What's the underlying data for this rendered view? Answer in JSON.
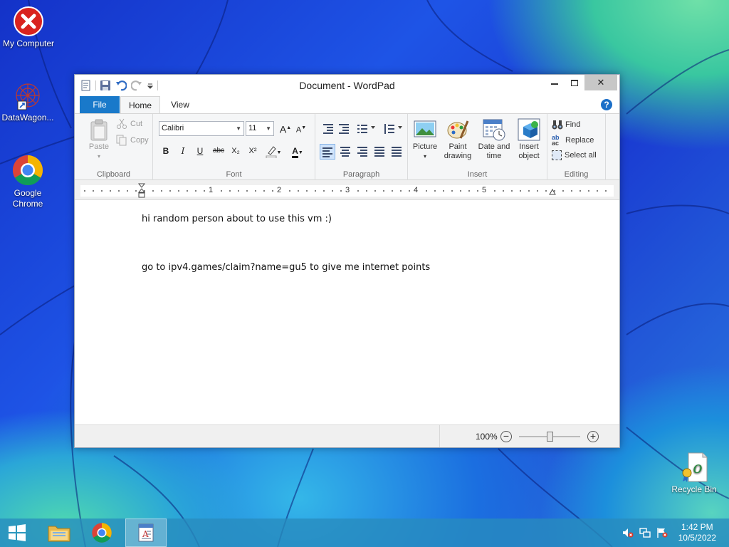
{
  "desktop": {
    "icons": [
      {
        "label": "My Computer"
      },
      {
        "label": "DataWagon..."
      },
      {
        "label": "Google Chrome"
      },
      {
        "label": "Recycle Bin"
      }
    ]
  },
  "window": {
    "title": "Document - WordPad",
    "tabs": {
      "file": "File",
      "home": "Home",
      "view": "View"
    },
    "help": "?",
    "controls": {
      "minimize": "—",
      "maximize": "☐",
      "close": "✕"
    }
  },
  "ribbon": {
    "clipboard": {
      "label": "Clipboard",
      "paste": "Paste",
      "cut": "Cut",
      "copy": "Copy"
    },
    "font": {
      "label": "Font",
      "family": "Calibri",
      "size": "11",
      "bold": "B",
      "italic": "I",
      "underline": "U",
      "strike": "abc",
      "subscript": "X₂",
      "superscript": "X²",
      "grow": "A",
      "shrink": "A",
      "color": "A"
    },
    "paragraph": {
      "label": "Paragraph"
    },
    "insert": {
      "label": "Insert",
      "picture": "Picture",
      "paint_line1": "Paint",
      "paint_line2": "drawing",
      "datetime_line1": "Date and",
      "datetime_line2": "time",
      "object_line1": "Insert",
      "object_line2": "object"
    },
    "editing": {
      "label": "Editing",
      "find": "Find",
      "replace": "Replace",
      "select_all": "Select all"
    }
  },
  "ruler": {
    "marks": [
      "1",
      "2",
      "3",
      "4",
      "5"
    ]
  },
  "document": {
    "lines": [
      "hi random person about to use this vm :)",
      "go to ipv4.games/claim?name=gu5 to give me internet points"
    ]
  },
  "status": {
    "zoom": "100%",
    "zoom_level_percent": 100
  },
  "taskbar": {
    "time": "1:42 PM",
    "date": "10/5/2022"
  },
  "colors": {
    "file_tab": "#1979ca",
    "accent": "#1b6fc8",
    "close_hover": "#c7c7c7"
  }
}
